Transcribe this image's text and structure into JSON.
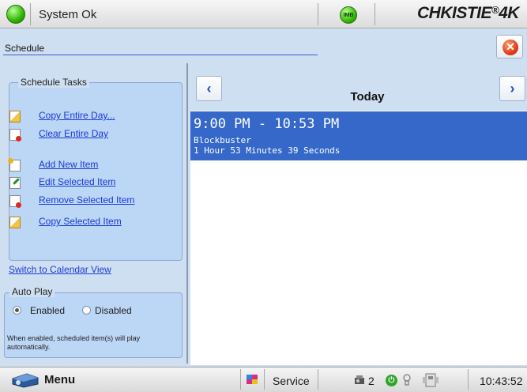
{
  "status": {
    "text": "System Ok",
    "imb_label": "IMB",
    "color": "#30b500"
  },
  "brand": "CHKISTIE 4K",
  "page": {
    "title": "Schedule"
  },
  "tasks": {
    "legend": "Schedule Tasks",
    "items": [
      {
        "label": "Copy Entire Day...",
        "icon": "copy-icon"
      },
      {
        "label": "Clear Entire Day",
        "icon": "clear-day-icon"
      },
      {
        "label": "Add New Item",
        "icon": "add-item-icon"
      },
      {
        "label": "Edit Selected Item",
        "icon": "edit-item-icon"
      },
      {
        "label": "Remove Selected Item",
        "icon": "remove-item-icon"
      },
      {
        "label": "Copy Selected Item",
        "icon": "copy-icon"
      }
    ]
  },
  "calendar_link": "Switch to Calendar View",
  "autoplay": {
    "legend": "Auto Play",
    "enabled_label": "Enabled",
    "disabled_label": "Disabled",
    "selected": "Enabled",
    "note": "When enabled, scheduled item(s) will play automatically."
  },
  "day": {
    "title": "Today",
    "prev_icon": "chevron-left-icon",
    "next_icon": "chevron-right-icon"
  },
  "schedule_items": [
    {
      "time": "9:00 PM - 10:53 PM",
      "name": "Blockbuster",
      "duration": "1 Hour 53 Minutes 39 Seconds"
    }
  ],
  "bottom": {
    "menu_label": "Menu",
    "service_label": "Service",
    "projector_count": "2",
    "clock": "10:43:52"
  },
  "colors": {
    "selected_row": "#3568c8",
    "link": "#1a3bd1",
    "panel": "#bcd6f6"
  }
}
